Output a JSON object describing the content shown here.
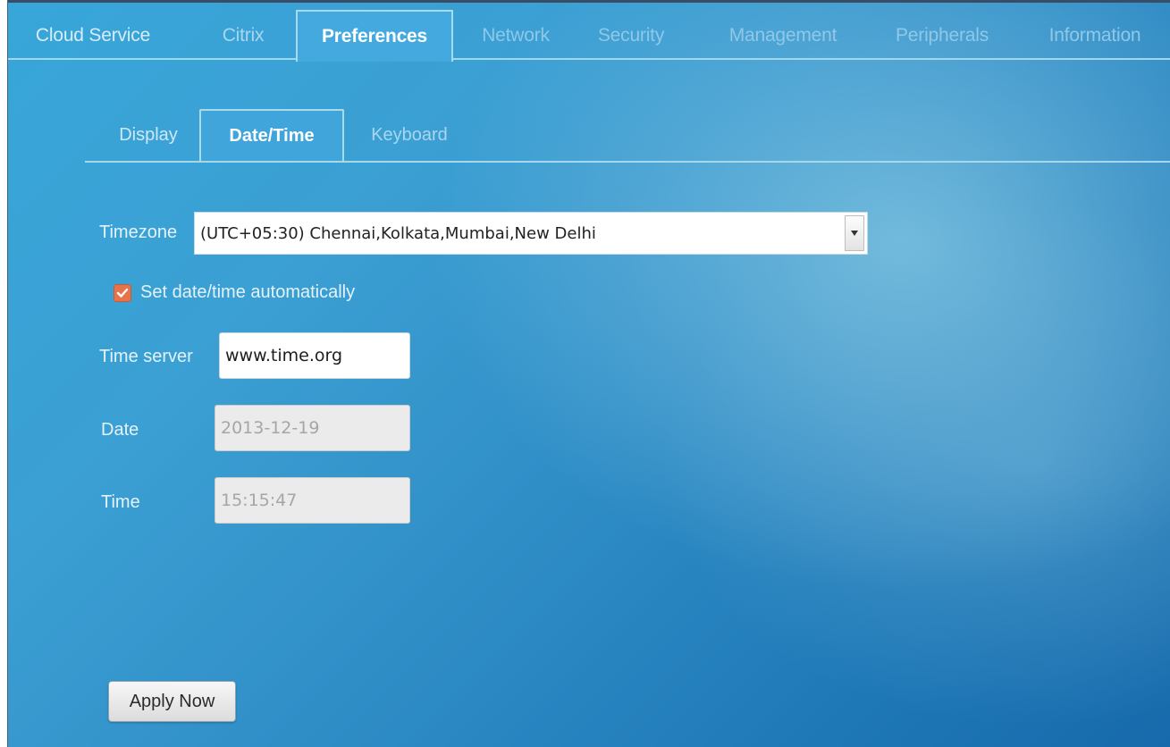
{
  "main_tabs": [
    {
      "label": "Cloud Service"
    },
    {
      "label": "Citrix"
    },
    {
      "label": "Preferences"
    },
    {
      "label": "Network"
    },
    {
      "label": "Security"
    },
    {
      "label": "Management"
    },
    {
      "label": "Peripherals"
    },
    {
      "label": "Information"
    }
  ],
  "active_main_tab": "Preferences",
  "sub_tabs": [
    {
      "label": "Display"
    },
    {
      "label": "Date/Time"
    },
    {
      "label": "Keyboard"
    }
  ],
  "active_sub_tab": "Date/Time",
  "form": {
    "timezone_label": "Timezone",
    "timezone_value": "(UTC+05:30) Chennai,Kolkata,Mumbai,New Delhi",
    "auto_checkbox_label": "Set date/time automatically",
    "auto_checked": true,
    "time_server_label": "Time server",
    "time_server_value": "www.time.org",
    "date_label": "Date",
    "date_value": "2013-12-19",
    "time_label": "Time",
    "time_value": "15:15:47"
  },
  "apply_button_label": "Apply Now",
  "colors": {
    "accent_checkbox": "#e8734a",
    "background": "#2f8dc6"
  }
}
